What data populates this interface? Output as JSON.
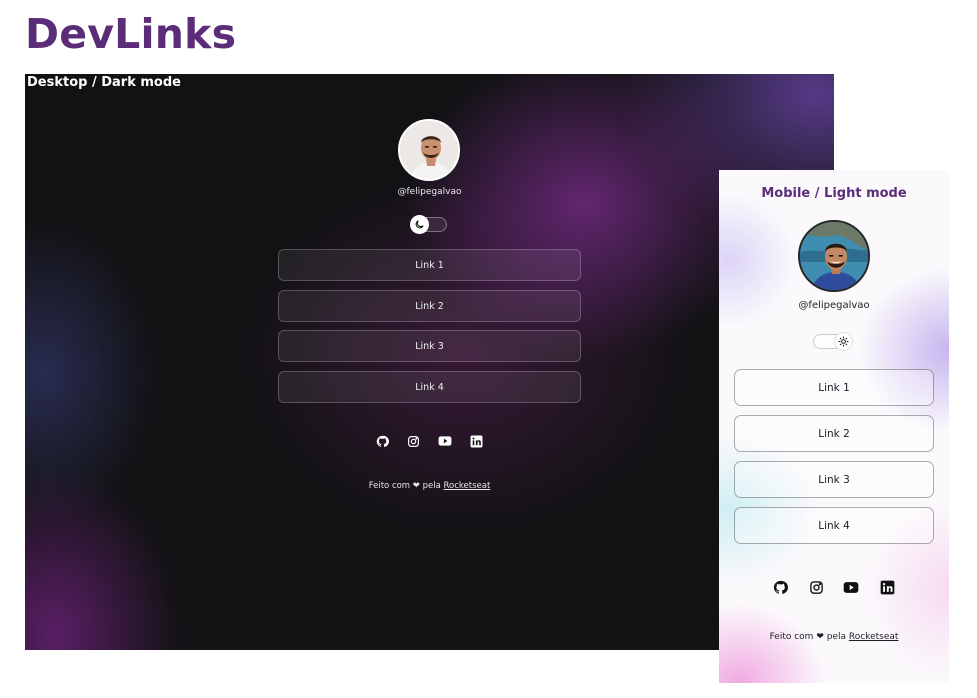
{
  "page": {
    "title": "DevLinks"
  },
  "desktop": {
    "label": "Desktop / Dark mode",
    "handle": "@felipegalvao",
    "links": [
      "Link 1",
      "Link 2",
      "Link 3",
      "Link 4"
    ],
    "social": [
      "github-icon",
      "instagram-icon",
      "youtube-icon",
      "linkedin-icon"
    ],
    "theme_toggle": {
      "state": "dark",
      "icon": "moon-icon"
    },
    "footer": {
      "prefix": "Feito com",
      "heart": "❤",
      "middle": "pela",
      "link": "Rocketseat"
    },
    "colors": {
      "background": "#121214",
      "accent": "#702a80",
      "text": "#f0f0f0"
    }
  },
  "mobile": {
    "label": "Mobile / Light mode",
    "handle": "@felipegalvao",
    "links": [
      "Link 1",
      "Link 2",
      "Link 3",
      "Link 4"
    ],
    "social": [
      "github-icon",
      "instagram-icon",
      "youtube-icon",
      "linkedin-icon"
    ],
    "theme_toggle": {
      "state": "light",
      "icon": "sun-icon"
    },
    "footer": {
      "prefix": "Feito com",
      "heart": "❤",
      "middle": "pela",
      "link": "Rocketseat"
    },
    "colors": {
      "background": "#fbf9fc",
      "accent": "#5b2d78",
      "text": "#1d1d21"
    }
  }
}
